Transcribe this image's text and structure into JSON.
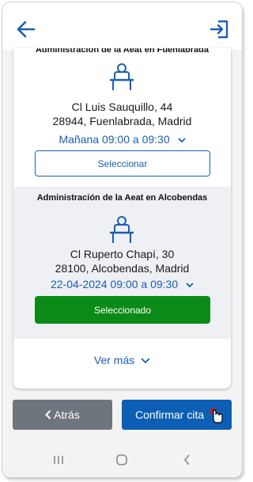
{
  "header": {
    "back_icon": "arrow-left-icon",
    "exit_icon": "logout-icon"
  },
  "offices": [
    {
      "name": "Administración de la Aeat en Fuenlabrada",
      "address_line1": "Cl Luis Sauquillo, 44",
      "address_line2": "28944, Fuenlabrada, Madrid",
      "time": "Mañana 09:00 a 09:30",
      "button": "Seleccionar",
      "selected": false
    },
    {
      "name": "Administración de la Aeat en Alcobendas",
      "address_line1": "Cl Ruperto Chapí, 30",
      "address_line2": "28100, Alcobendas, Madrid",
      "time": "22-04-2024 09:00 a 09:30",
      "button": "Seleccionado",
      "selected": true
    }
  ],
  "more_label": "Ver más",
  "footer": {
    "back_label": "Atrás",
    "confirm_label": "Confirmar cita"
  },
  "colors": {
    "primary": "#0d5fb5",
    "selected": "#0c8a17",
    "secondary": "#6e757c"
  }
}
